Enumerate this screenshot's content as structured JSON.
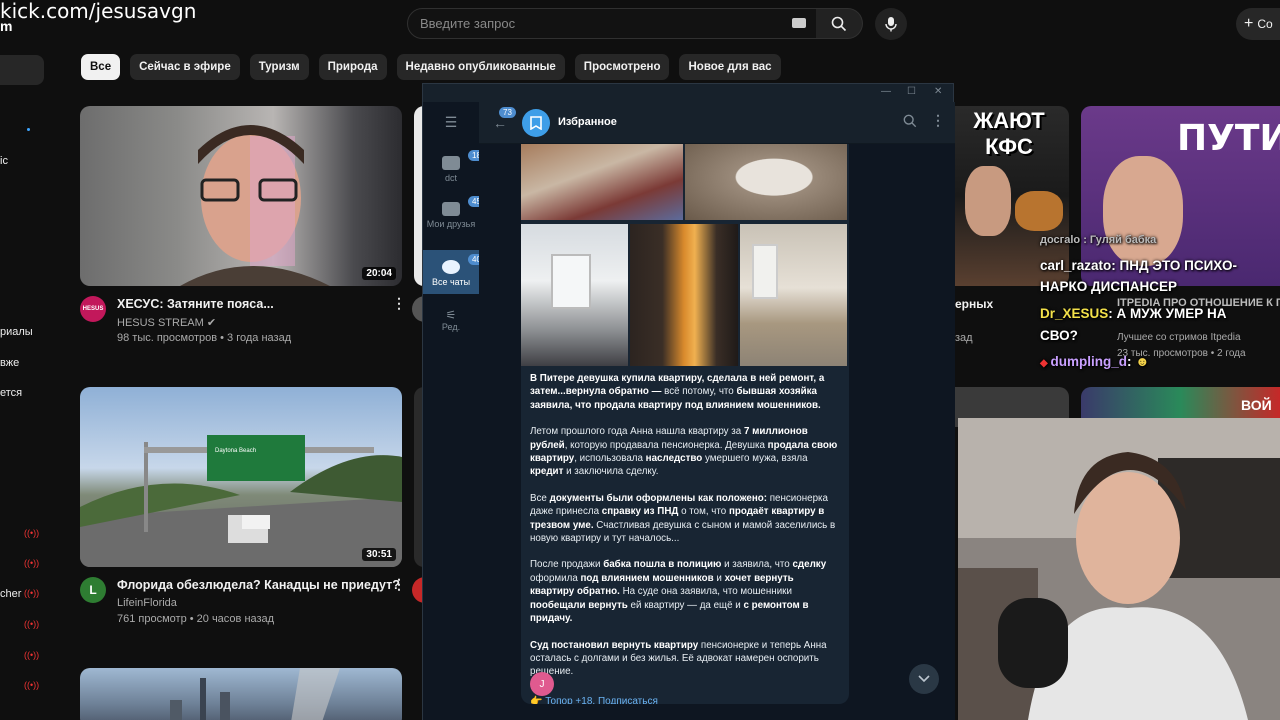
{
  "overlay": {
    "kick_url": "kick.com/jesusavgn",
    "kick_sub": "m"
  },
  "youtube": {
    "search_placeholder": "Введите запрос",
    "create_label": "Со",
    "sidebar": [
      "ic",
      "риалы",
      "вже",
      "ется",
      "cher"
    ],
    "chips": [
      "Все",
      "Сейчас в эфире",
      "Туризм",
      "Природа",
      "Недавно опубликованные",
      "Просмотрено",
      "Новое для вас"
    ],
    "videos": [
      {
        "title": "ХЕСУС: Затяните пояса...",
        "channel": "HESUS STREAM",
        "meta": "98 тыс. просмотров • 3 года назад",
        "duration": "20:04",
        "avatar": "HESUS"
      },
      {
        "title": "Флорида обезлюдела? Канадцы не приедут?",
        "channel": "LifeinFlorida",
        "meta": "761 просмотр • 20 часов назад",
        "duration": "30:51",
        "avatar": "L"
      }
    ],
    "right_cards": [
      {
        "title": "ерных",
        "meta": "зад"
      },
      {
        "title": "ITPEDIA ПРО ОТНОШЕНИЕ К ГРАНИЦЫ, СССР, КОРЕЙЦА",
        "channel": "Лучшее со стримов Itpedia",
        "meta": "23 тыс. просмотров • 2 года"
      }
    ],
    "thumb_text": {
      "kfs": "ЖАЮТ КФС",
      "puti": "ПУТИ",
      "voi": "ВОЙ",
      "sign": "Daytona Beach"
    }
  },
  "telegram": {
    "chat_name": "Избранное",
    "unread": "73",
    "folders": [
      {
        "label": "dct",
        "badge": "184"
      },
      {
        "label": "Мои друзья",
        "badge": "45"
      },
      {
        "label": "Все чаты",
        "badge": "404"
      },
      {
        "label": "Ред.",
        "badge": ""
      }
    ],
    "post_paragraphs": [
      [
        {
          "t": "В Питере девушка купила квартиру, сделала в ней ремонт, а затем...вернула обратно — ",
          "b": true
        },
        {
          "t": "всё потому, что ",
          "b": false
        },
        {
          "t": "бывшая хозяйка заявила",
          "b": true
        },
        {
          "t": ", что продала квартиру под влиянием мошенников.",
          "b": true
        }
      ],
      [
        {
          "t": "Летом прошлого года Анна нашла квартиру за ",
          "b": false
        },
        {
          "t": "7 миллионов рублей",
          "b": true
        },
        {
          "t": ", которую продавала пенсионерка. Девушка ",
          "b": false
        },
        {
          "t": "продала свою квартиру",
          "b": true
        },
        {
          "t": ", использовала ",
          "b": false
        },
        {
          "t": "наследство",
          "b": true
        },
        {
          "t": " умершего мужа, взяла ",
          "b": false
        },
        {
          "t": "кредит",
          "b": true
        },
        {
          "t": " и заключила сделку.",
          "b": false
        }
      ],
      [
        {
          "t": "Все ",
          "b": false
        },
        {
          "t": "документы были оформлены как положено:",
          "b": true
        },
        {
          "t": " пенсионерка даже принесла ",
          "b": false
        },
        {
          "t": "справку из ПНД",
          "b": true
        },
        {
          "t": " о том, что ",
          "b": false
        },
        {
          "t": "продаёт квартиру в трезвом уме.",
          "b": true
        },
        {
          "t": " Счастливая девушка с сыном и мамой заселились в новую квартиру и тут началось...",
          "b": false
        }
      ],
      [
        {
          "t": "После продажи ",
          "b": false
        },
        {
          "t": "бабка пошла в полицию",
          "b": true
        },
        {
          "t": " и заявила, что ",
          "b": false
        },
        {
          "t": "сделку",
          "b": true
        },
        {
          "t": " оформила ",
          "b": false
        },
        {
          "t": "под влиянием мошенников",
          "b": true
        },
        {
          "t": " и ",
          "b": false
        },
        {
          "t": "хочет вернуть квартиру обратно.",
          "b": true
        },
        {
          "t": " На суде она заявила, что мошенники ",
          "b": false
        },
        {
          "t": "пообещали вернуть",
          "b": true
        },
        {
          "t": " ей квартиру — да ещё и ",
          "b": false
        },
        {
          "t": "с ремонтом в придачу.",
          "b": true
        }
      ],
      [
        {
          "t": "Суд постановил вернуть квартиру",
          "b": true
        },
        {
          "t": " пенсионерке и теперь Анна осталась с долгами и без жилья. Её адвокат намерен оспорить решение.",
          "b": false
        }
      ]
    ],
    "footer": "👉 Топор +18. Подписаться",
    "sender_initial": "J"
  },
  "stream_chat": [
    {
      "user": "carl_razato",
      "text": ": ПНД ЭТО ПСИХО-",
      "color": "#ffffff"
    },
    {
      "user": "",
      "text": "НАРКО ДИСПАНСЕР",
      "color": "#ffffff"
    },
    {
      "user": "Dr_XESUS",
      "text": ": А МУЖ УМЕР НА",
      "color": "#f3e14a"
    },
    {
      "user": "",
      "text": "СВО?",
      "color": "#ffffff"
    },
    {
      "user": "dumpling_d",
      "text": ":",
      "color": "#c9a0ff"
    }
  ],
  "chat_partial": "досгаlo : Гуляй бабка"
}
